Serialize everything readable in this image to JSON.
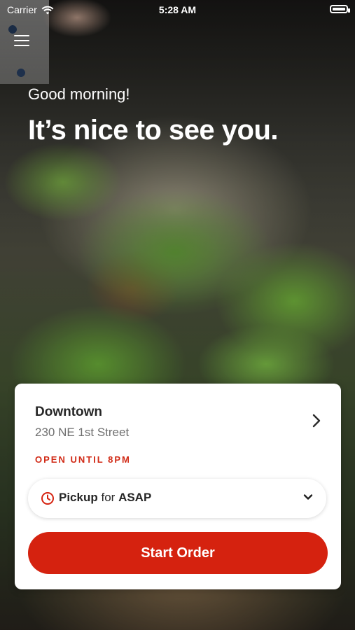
{
  "status_bar": {
    "carrier": "Carrier",
    "time": "5:28 AM"
  },
  "hero": {
    "greeting": "Good morning!",
    "headline": "It’s nice to see you."
  },
  "location": {
    "name": "Downtown",
    "address": "230 NE 1st Street",
    "hours": "OPEN UNTIL 8PM"
  },
  "order_mode": {
    "mode": "Pickup",
    "connector": "for",
    "time": "ASAP"
  },
  "cta": {
    "start_order": "Start Order"
  },
  "colors": {
    "accent_red": "#d5220f",
    "hours_red": "#d12a16",
    "card_bg": "#ffffff"
  },
  "icons": [
    "wifi-icon",
    "battery-icon",
    "menu-icon",
    "chevron-right-icon",
    "clock-icon",
    "chevron-down-icon"
  ]
}
